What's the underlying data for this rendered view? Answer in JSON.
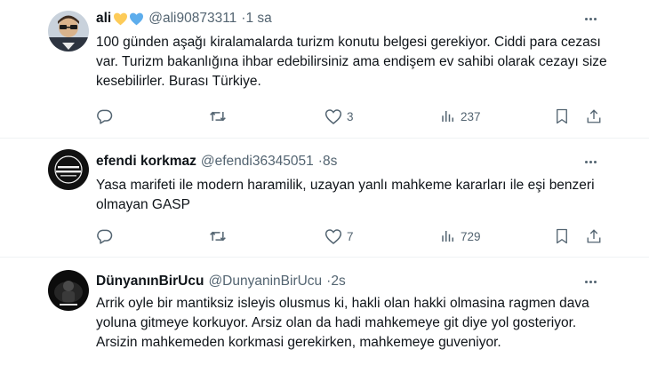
{
  "tweets": [
    {
      "display_name": "ali",
      "handle": "@ali90873311",
      "time": "1 sa",
      "text": "100 günden aşağı kiralamalarda turizm konutu belgesi gerekiyor. Ciddi para cezası var. Turizm bakanlığına ihbar edebilirsiniz ama endişem ev sahibi olarak cezayı size kesebilirler. Burası Türkiye.",
      "emoji_hearts": [
        "yellow-heart",
        "blue-heart"
      ],
      "likes": "3",
      "views": "237"
    },
    {
      "display_name": "efendi korkmaz",
      "handle": "@efendi36345051",
      "time": "8s",
      "text": "Yasa marifeti ile modern haramilik, uzayan yanlı mahkeme kararları ile eşi benzeri olmayan GASP",
      "likes": "7",
      "views": "729"
    },
    {
      "display_name": "DünyanınBirUcu",
      "handle": "@DunyaninBirUcu",
      "time": "2s",
      "text": "Arrik oyle bir mantiksiz isleyis olusmus ki, hakli olan hakki olmasina ragmen dava yoluna gitmeye korkuyor. Arsiz olan da hadi mahkemeye git diye yol gosteriyor. Arsizin mahkemeden korkmasi gerekirken, mahkemeye guveniyor."
    }
  ],
  "separator": "·",
  "colors": {
    "text": "#0f1419",
    "muted": "#536471",
    "divider": "#eff3f4",
    "yellow_heart": "#fdcb58",
    "blue_heart": "#5dadec"
  },
  "icons": [
    "reply-icon",
    "retweet-icon",
    "like-icon",
    "views-icon",
    "bookmark-icon",
    "share-icon",
    "more-icon"
  ]
}
